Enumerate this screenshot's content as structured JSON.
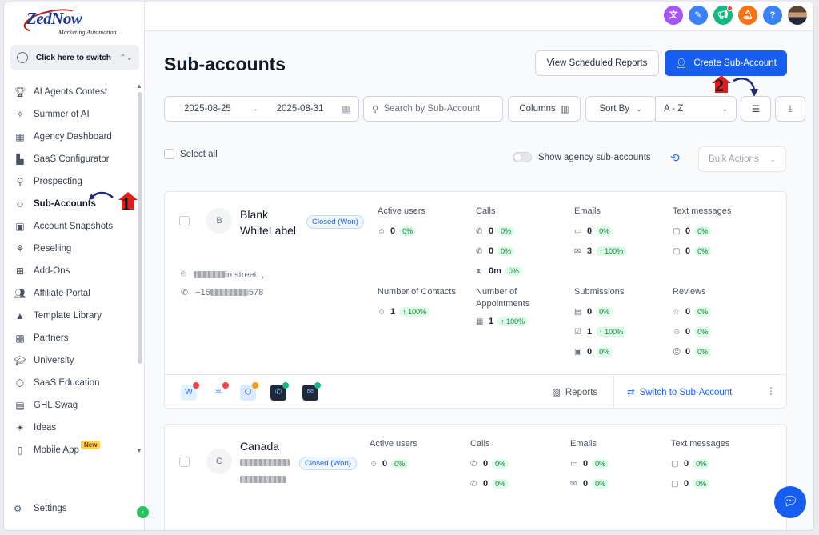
{
  "logo": {
    "brand": "ZedNow",
    "tagline": "Marketing Automation"
  },
  "switcher": {
    "label": "Click here to switch"
  },
  "sidebar": {
    "items": [
      {
        "label": "AI Agents Contest",
        "icon": "trophy-icon"
      },
      {
        "label": "Summer of AI",
        "icon": "sparkle-icon"
      },
      {
        "label": "Agency Dashboard",
        "icon": "dashboard-icon"
      },
      {
        "label": "SaaS Configurator",
        "icon": "chart-icon"
      },
      {
        "label": "Prospecting",
        "icon": "prospect-icon"
      },
      {
        "label": "Sub-Accounts",
        "icon": "user-icon",
        "active": true
      },
      {
        "label": "Account Snapshots",
        "icon": "snapshot-icon"
      },
      {
        "label": "Reselling",
        "icon": "reselling-icon"
      },
      {
        "label": "Add-Ons",
        "icon": "addons-icon"
      },
      {
        "label": "Affiliate Portal",
        "icon": "users-icon"
      },
      {
        "label": "Template Library",
        "icon": "template-icon"
      },
      {
        "label": "Partners",
        "icon": "partners-icon"
      },
      {
        "label": "University",
        "icon": "graduation-icon"
      },
      {
        "label": "SaaS Education",
        "icon": "education-icon"
      },
      {
        "label": "GHL Swag",
        "icon": "shirt-icon"
      },
      {
        "label": "Ideas",
        "icon": "bulb-icon"
      },
      {
        "label": "Mobile App",
        "icon": "mobile-icon",
        "badge": "New"
      }
    ],
    "settings": "Settings"
  },
  "topbar": {
    "icons": [
      "translate-icon",
      "ticket-icon",
      "megaphone-icon",
      "bell-icon",
      "help-icon",
      "avatar"
    ],
    "help_label": "?"
  },
  "page": {
    "title": "Sub-accounts",
    "view_scheduled": "View Scheduled Reports",
    "create": "Create Sub-Account"
  },
  "filters": {
    "date_from": "2025-08-25",
    "date_to": "2025-08-31",
    "search_placeholder": "Search by Sub-Account",
    "columns": "Columns",
    "sort_by": "Sort By",
    "sort_value": "A - Z"
  },
  "list": {
    "select_all": "Select all",
    "show_agency": "Show agency sub-accounts",
    "bulk_actions": "Bulk Actions"
  },
  "cards": [
    {
      "avatar": "B",
      "name": "Blank WhiteLabel",
      "status": "Closed (Won)",
      "address_suffix": "in street, ,",
      "phone_prefix": "+15",
      "phone_suffix": "578",
      "active_users": {
        "label": "Active users",
        "value": "0",
        "pct": "0%"
      },
      "calls": {
        "label": "Calls",
        "rows": [
          {
            "v": "0",
            "p": "0%"
          },
          {
            "v": "0",
            "p": "0%"
          },
          {
            "v": "0m",
            "p": "0%"
          }
        ]
      },
      "emails": {
        "label": "Emails",
        "rows": [
          {
            "v": "0",
            "p": "0%"
          },
          {
            "v": "3",
            "p": "100%"
          }
        ]
      },
      "texts": {
        "label": "Text messages",
        "rows": [
          {
            "v": "0",
            "p": "0%"
          },
          {
            "v": "0",
            "p": "0%"
          }
        ]
      },
      "contacts": {
        "label": "Number of Contacts",
        "value": "1",
        "pct": "100%"
      },
      "appointments": {
        "label": "Number of Appointments",
        "value": "1",
        "pct": "100%"
      },
      "submissions": {
        "label": "Submissions",
        "rows": [
          {
            "v": "0",
            "p": "0%"
          },
          {
            "v": "1",
            "p": "100%"
          },
          {
            "v": "0",
            "p": "0%"
          }
        ]
      },
      "reviews": {
        "label": "Reviews",
        "rows": [
          {
            "v": "0",
            "p": "0%"
          },
          {
            "v": "0",
            "p": "0%"
          },
          {
            "v": "0",
            "p": "0%"
          }
        ]
      },
      "footer": {
        "reports": "Reports",
        "switch": "Switch to Sub-Account"
      }
    },
    {
      "avatar": "C",
      "name": "Canada",
      "status": "Closed (Won)",
      "active_users": {
        "label": "Active users",
        "value": "0",
        "pct": "0%"
      },
      "calls": {
        "label": "Calls",
        "rows": [
          {
            "v": "0",
            "p": "0%"
          },
          {
            "v": "0",
            "p": "0%"
          }
        ]
      },
      "emails": {
        "label": "Emails",
        "rows": [
          {
            "v": "0",
            "p": "0%"
          },
          {
            "v": "0",
            "p": "0%"
          }
        ]
      },
      "texts": {
        "label": "Text messages",
        "rows": [
          {
            "v": "0",
            "p": "0%"
          },
          {
            "v": "0",
            "p": "0%"
          }
        ]
      }
    }
  ],
  "annotations": {
    "step1": "1",
    "step2": "2"
  },
  "colors": {
    "primary": "#155eef",
    "success_bg": "#dcfce7",
    "success_text": "#15803d",
    "annotation_red": "#e11d1d"
  }
}
